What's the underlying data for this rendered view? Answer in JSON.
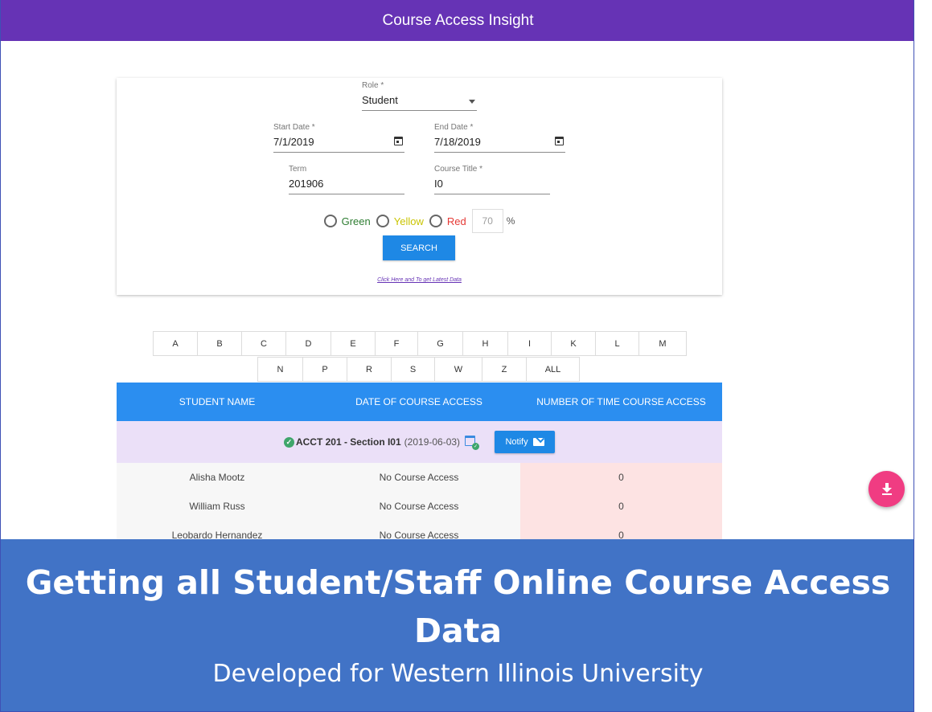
{
  "app": {
    "title": "Course Access Insight"
  },
  "form": {
    "role": {
      "label": "Role *",
      "value": "Student"
    },
    "start_date": {
      "label": "Start Date *",
      "value": "7/1/2019"
    },
    "end_date": {
      "label": "End Date *",
      "value": "7/18/2019"
    },
    "term": {
      "label": "Term",
      "value": "201906"
    },
    "course_title": {
      "label": "Course Title *",
      "value": "I0"
    },
    "radios": [
      {
        "label": "Green",
        "color": "#2e7d32"
      },
      {
        "label": "Yellow",
        "color": "#c9c400"
      },
      {
        "label": "Red",
        "color": "#e53935"
      }
    ],
    "threshold": {
      "value": "70",
      "unit": "%"
    },
    "search_label": "SEARCH",
    "latest_link": "Click Here and To get Latest Data"
  },
  "alphabet": {
    "row1": [
      "A",
      "B",
      "C",
      "D",
      "E",
      "F",
      "G",
      "H",
      "I",
      "K",
      "L",
      "M"
    ],
    "row2": [
      "N",
      "P",
      "R",
      "S",
      "W",
      "Z",
      "ALL"
    ]
  },
  "table": {
    "headers": [
      "STUDENT NAME",
      "DATE OF COURSE ACCESS",
      "NUMBER OF TIME COURSE ACCESS"
    ],
    "section": {
      "title": "ACCT 201 - Section I01",
      "date": "(2019-06-03)",
      "notify_label": "Notify"
    },
    "rows": [
      {
        "name": "Alisha Mootz",
        "access": "No Course Access",
        "count": "0"
      },
      {
        "name": "William Russ",
        "access": "No Course Access",
        "count": "0"
      },
      {
        "name": "Leobardo Hernandez",
        "access": "No Course Access",
        "count": "0"
      }
    ]
  },
  "banner": {
    "headline": "Getting all Student/Staff Online Course Access Data",
    "subtitle": "Developed for Western Illinois University"
  },
  "colors": {
    "appbar": "#6633b5",
    "primary": "#1e88e5",
    "table_header": "#2b8ef0",
    "fab": "#f03c82",
    "banner": "#4173c6"
  },
  "icons": {
    "role_dropdown": "chevron-down-icon",
    "date_picker": "calendar-icon",
    "section_check": "check-circle-icon",
    "event": "event-available-icon",
    "notify": "mail-icon",
    "fab": "download-icon"
  }
}
